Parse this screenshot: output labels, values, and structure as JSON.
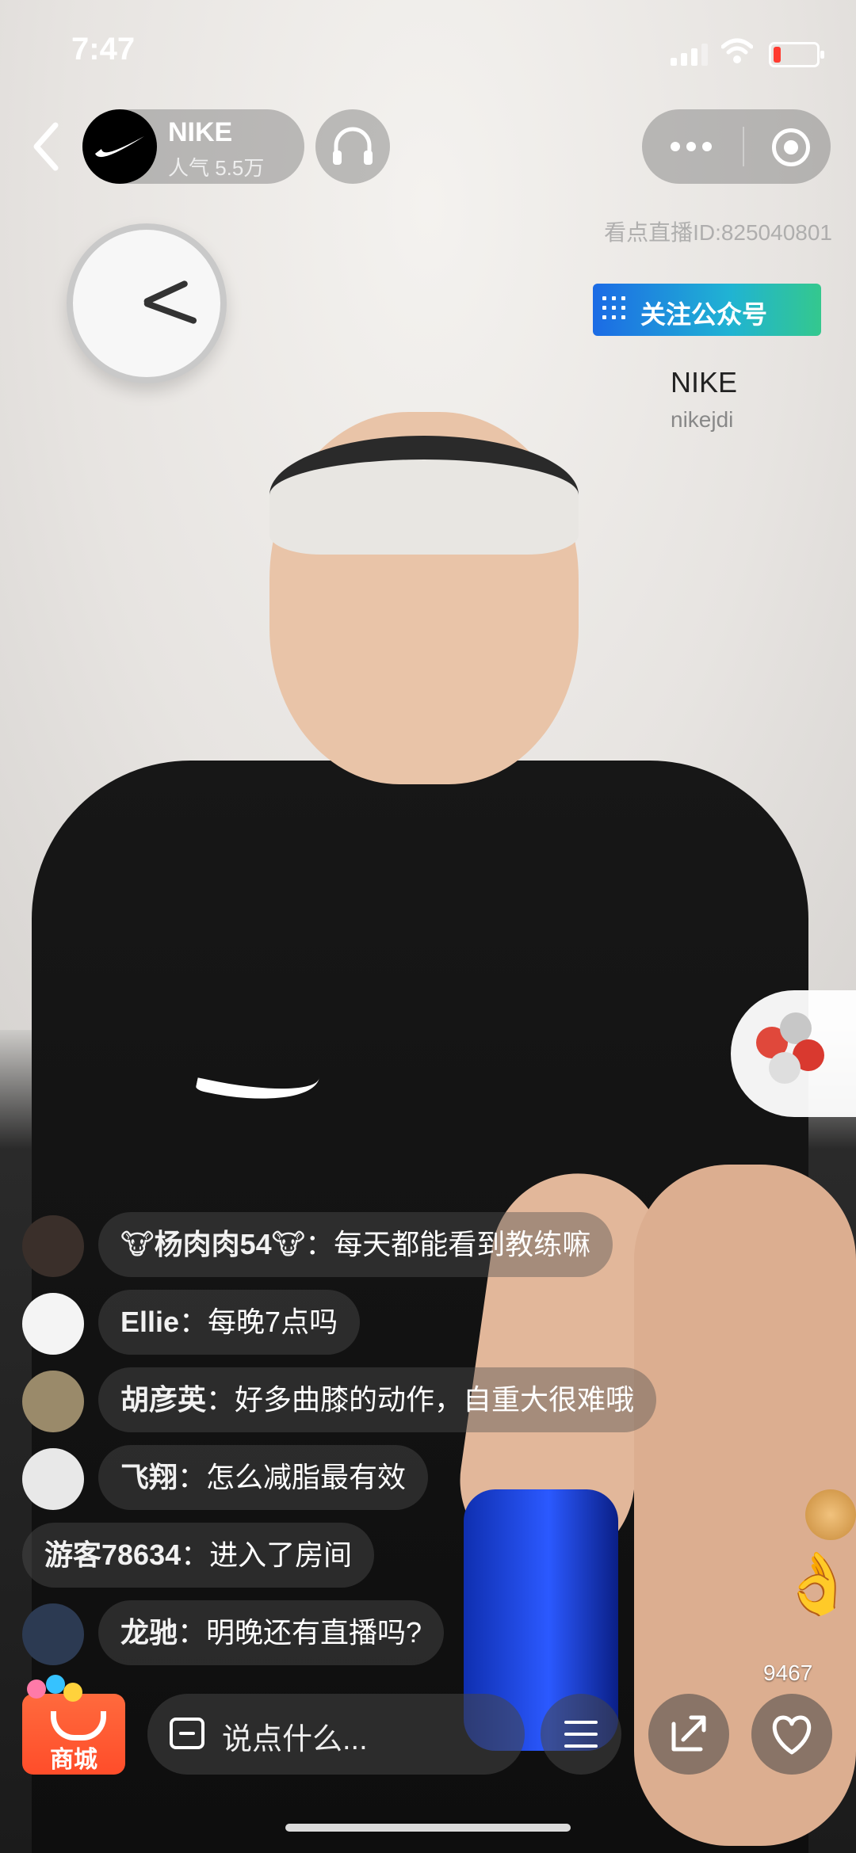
{
  "status": {
    "time": "7:47"
  },
  "header": {
    "streamer_name": "NIKE",
    "popularity": "人气 5.5万",
    "live_id": "看点直播ID:825040801"
  },
  "follow_widget": {
    "button_label": "关注公众号",
    "account_name": "NIKE",
    "account_id": "nikejdi"
  },
  "chat": {
    "messages": [
      {
        "user": "🐮杨肉肉54🐮",
        "text": "：每天都能看到教练嘛"
      },
      {
        "user": "Ellie",
        "text": "：每晚7点吗"
      },
      {
        "user": "胡彦英",
        "text": "：好多曲膝的动作，自重大很难哦"
      },
      {
        "user": "飞翔",
        "text": "：怎么减脂最有效"
      },
      {
        "user": "游客78634",
        "text": "：进入了房间"
      },
      {
        "user": "龙驰",
        "text": "：明晚还有直播吗?"
      }
    ]
  },
  "likes": {
    "count": "9467"
  },
  "bottom_bar": {
    "shop_label": "商城",
    "input_placeholder": "说点什么..."
  },
  "colors": {
    "shop": "#ff5533",
    "follow_gradient_start": "#1c6be5",
    "follow_gradient_end": "#34c88e",
    "bottle": "#2b59ff"
  },
  "icons": [
    "back-icon",
    "headphones-icon",
    "more-dots-icon",
    "close-target-icon",
    "chat-bubble-icon",
    "menu-icon",
    "share-icon",
    "heart-icon"
  ]
}
